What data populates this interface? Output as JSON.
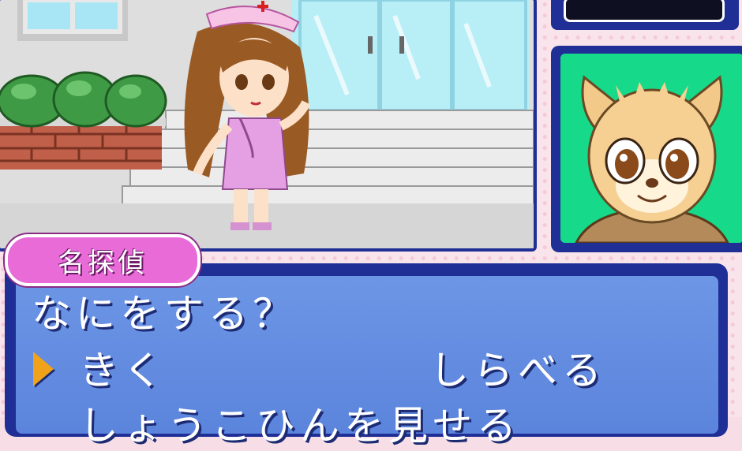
{
  "speaker": {
    "name": "名探偵"
  },
  "dialog": {
    "prompt": "なにをする？",
    "options": [
      "きく",
      "しらべる",
      "しょうこひんを見せる"
    ],
    "selected_index": 0
  },
  "colors": {
    "frame": "#1f2f95",
    "dialog_fill": "#6d96e6",
    "name_tag": "#e86bd8",
    "portrait_bg": "#17d98a",
    "cursor": "#f0a21a"
  },
  "icons": {
    "cursor": "triangle-cursor-icon"
  }
}
